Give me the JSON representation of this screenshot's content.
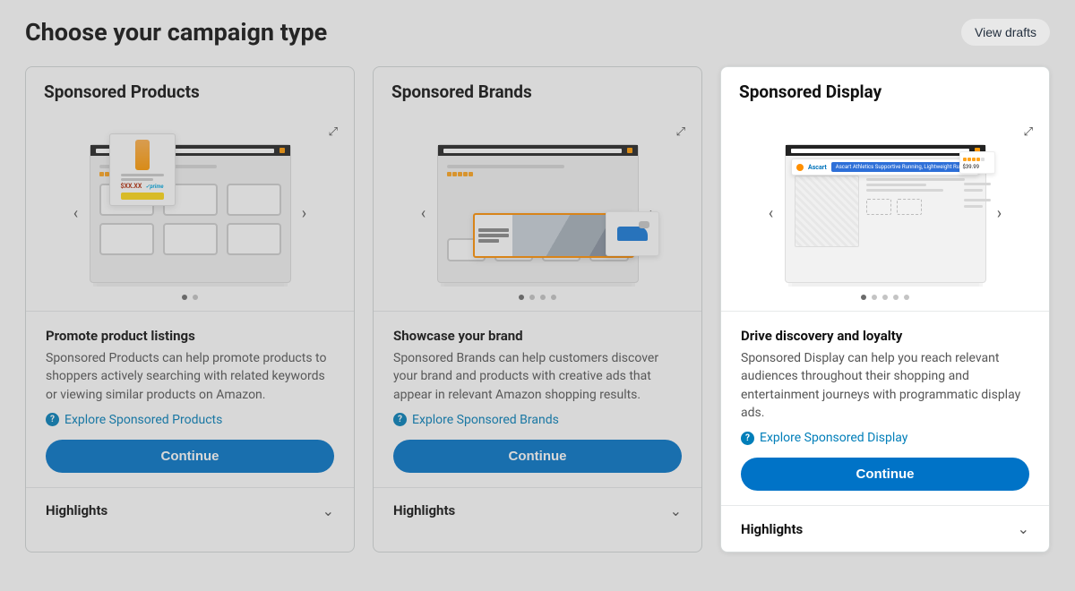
{
  "header": {
    "title": "Choose your campaign type",
    "view_drafts": "View drafts"
  },
  "cards": [
    {
      "title": "Sponsored Products",
      "dots": 2,
      "active_dot": 0,
      "desc_title": "Promote product listings",
      "desc_text": "Sponsored Products can help promote products to shoppers actively searching with related keywords or viewing similar products on Amazon.",
      "explore": "Explore Sponsored Products",
      "continue": "Continue",
      "highlights": "Highlights"
    },
    {
      "title": "Sponsored Brands",
      "dots": 4,
      "active_dot": 0,
      "desc_title": "Showcase your brand",
      "desc_text": "Sponsored Brands can help customers discover your brand and products with creative ads that appear in relevant Amazon shopping results.",
      "explore": "Explore Sponsored Brands",
      "continue": "Continue",
      "highlights": "Highlights"
    },
    {
      "title": "Sponsored Display",
      "dots": 5,
      "active_dot": 0,
      "desc_title": "Drive discovery and loyalty",
      "desc_text": "Sponsored Display can help you reach relevant audiences throughout their shopping and entertainment journeys with programmatic display ads.",
      "explore": "Explore Sponsored Display",
      "continue": "Continue",
      "highlights": "Highlights",
      "mock": {
        "brand": "Ascart",
        "pill": "Ascart Athletics Supportive Running, Lightweight Running...",
        "price": "$39.99"
      }
    }
  ]
}
